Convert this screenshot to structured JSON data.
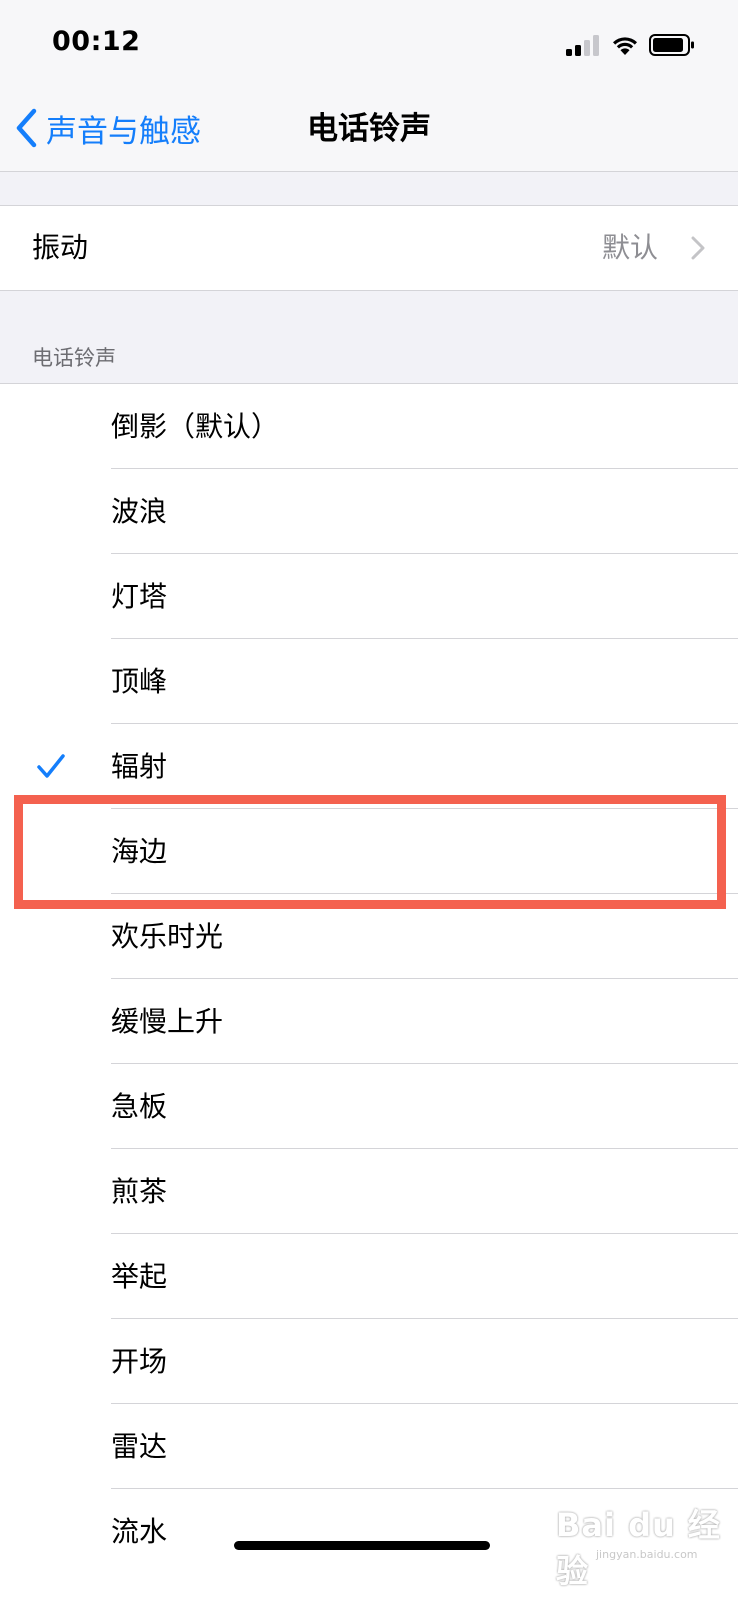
{
  "status_bar": {
    "time": "00:12",
    "icons": [
      "cellular-signal-icon",
      "wifi-icon",
      "battery-icon"
    ]
  },
  "nav": {
    "back_label": "声音与触感",
    "title": "电话铃声"
  },
  "vibration": {
    "label": "振动",
    "value": "默认"
  },
  "section_header": "电话铃声",
  "ringtones": [
    {
      "label": "倒影（默认）",
      "selected": false
    },
    {
      "label": "波浪",
      "selected": false
    },
    {
      "label": "灯塔",
      "selected": false
    },
    {
      "label": "顶峰",
      "selected": false
    },
    {
      "label": "辐射",
      "selected": true
    },
    {
      "label": "海边",
      "selected": false,
      "highlighted": true
    },
    {
      "label": "欢乐时光",
      "selected": false
    },
    {
      "label": "缓慢上升",
      "selected": false
    },
    {
      "label": "急板",
      "selected": false
    },
    {
      "label": "煎茶",
      "selected": false
    },
    {
      "label": "举起",
      "selected": false
    },
    {
      "label": "开场",
      "selected": false
    },
    {
      "label": "雷达",
      "selected": false
    },
    {
      "label": "流水",
      "selected": false
    }
  ],
  "watermark": {
    "text": "Bai du 经验",
    "url": "jingyan.baidu.com"
  },
  "colors": {
    "accent": "#147efb",
    "highlight": "#f4614f",
    "secondary_text": "#8e8e93",
    "background": "#f2f2f7"
  }
}
